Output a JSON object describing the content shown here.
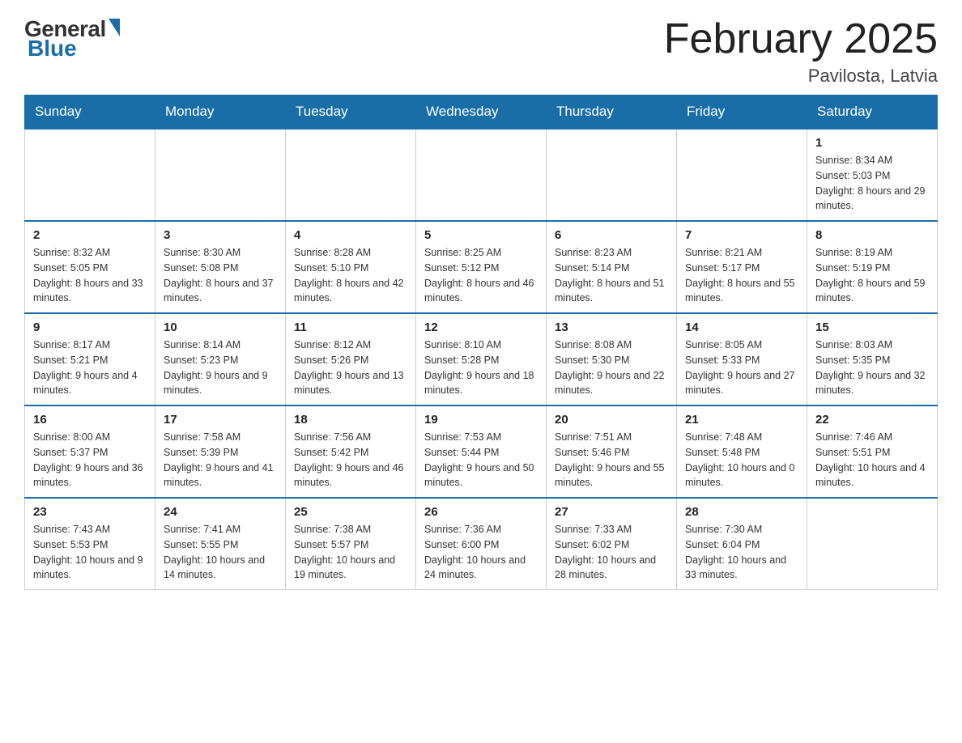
{
  "logo": {
    "general": "General",
    "blue": "Blue"
  },
  "title": {
    "month_year": "February 2025",
    "location": "Pavilosta, Latvia"
  },
  "headers": [
    "Sunday",
    "Monday",
    "Tuesday",
    "Wednesday",
    "Thursday",
    "Friday",
    "Saturday"
  ],
  "weeks": [
    [
      {
        "day": "",
        "info": ""
      },
      {
        "day": "",
        "info": ""
      },
      {
        "day": "",
        "info": ""
      },
      {
        "day": "",
        "info": ""
      },
      {
        "day": "",
        "info": ""
      },
      {
        "day": "",
        "info": ""
      },
      {
        "day": "1",
        "info": "Sunrise: 8:34 AM\nSunset: 5:03 PM\nDaylight: 8 hours and 29 minutes."
      }
    ],
    [
      {
        "day": "2",
        "info": "Sunrise: 8:32 AM\nSunset: 5:05 PM\nDaylight: 8 hours and 33 minutes."
      },
      {
        "day": "3",
        "info": "Sunrise: 8:30 AM\nSunset: 5:08 PM\nDaylight: 8 hours and 37 minutes."
      },
      {
        "day": "4",
        "info": "Sunrise: 8:28 AM\nSunset: 5:10 PM\nDaylight: 8 hours and 42 minutes."
      },
      {
        "day": "5",
        "info": "Sunrise: 8:25 AM\nSunset: 5:12 PM\nDaylight: 8 hours and 46 minutes."
      },
      {
        "day": "6",
        "info": "Sunrise: 8:23 AM\nSunset: 5:14 PM\nDaylight: 8 hours and 51 minutes."
      },
      {
        "day": "7",
        "info": "Sunrise: 8:21 AM\nSunset: 5:17 PM\nDaylight: 8 hours and 55 minutes."
      },
      {
        "day": "8",
        "info": "Sunrise: 8:19 AM\nSunset: 5:19 PM\nDaylight: 8 hours and 59 minutes."
      }
    ],
    [
      {
        "day": "9",
        "info": "Sunrise: 8:17 AM\nSunset: 5:21 PM\nDaylight: 9 hours and 4 minutes."
      },
      {
        "day": "10",
        "info": "Sunrise: 8:14 AM\nSunset: 5:23 PM\nDaylight: 9 hours and 9 minutes."
      },
      {
        "day": "11",
        "info": "Sunrise: 8:12 AM\nSunset: 5:26 PM\nDaylight: 9 hours and 13 minutes."
      },
      {
        "day": "12",
        "info": "Sunrise: 8:10 AM\nSunset: 5:28 PM\nDaylight: 9 hours and 18 minutes."
      },
      {
        "day": "13",
        "info": "Sunrise: 8:08 AM\nSunset: 5:30 PM\nDaylight: 9 hours and 22 minutes."
      },
      {
        "day": "14",
        "info": "Sunrise: 8:05 AM\nSunset: 5:33 PM\nDaylight: 9 hours and 27 minutes."
      },
      {
        "day": "15",
        "info": "Sunrise: 8:03 AM\nSunset: 5:35 PM\nDaylight: 9 hours and 32 minutes."
      }
    ],
    [
      {
        "day": "16",
        "info": "Sunrise: 8:00 AM\nSunset: 5:37 PM\nDaylight: 9 hours and 36 minutes."
      },
      {
        "day": "17",
        "info": "Sunrise: 7:58 AM\nSunset: 5:39 PM\nDaylight: 9 hours and 41 minutes."
      },
      {
        "day": "18",
        "info": "Sunrise: 7:56 AM\nSunset: 5:42 PM\nDaylight: 9 hours and 46 minutes."
      },
      {
        "day": "19",
        "info": "Sunrise: 7:53 AM\nSunset: 5:44 PM\nDaylight: 9 hours and 50 minutes."
      },
      {
        "day": "20",
        "info": "Sunrise: 7:51 AM\nSunset: 5:46 PM\nDaylight: 9 hours and 55 minutes."
      },
      {
        "day": "21",
        "info": "Sunrise: 7:48 AM\nSunset: 5:48 PM\nDaylight: 10 hours and 0 minutes."
      },
      {
        "day": "22",
        "info": "Sunrise: 7:46 AM\nSunset: 5:51 PM\nDaylight: 10 hours and 4 minutes."
      }
    ],
    [
      {
        "day": "23",
        "info": "Sunrise: 7:43 AM\nSunset: 5:53 PM\nDaylight: 10 hours and 9 minutes."
      },
      {
        "day": "24",
        "info": "Sunrise: 7:41 AM\nSunset: 5:55 PM\nDaylight: 10 hours and 14 minutes."
      },
      {
        "day": "25",
        "info": "Sunrise: 7:38 AM\nSunset: 5:57 PM\nDaylight: 10 hours and 19 minutes."
      },
      {
        "day": "26",
        "info": "Sunrise: 7:36 AM\nSunset: 6:00 PM\nDaylight: 10 hours and 24 minutes."
      },
      {
        "day": "27",
        "info": "Sunrise: 7:33 AM\nSunset: 6:02 PM\nDaylight: 10 hours and 28 minutes."
      },
      {
        "day": "28",
        "info": "Sunrise: 7:30 AM\nSunset: 6:04 PM\nDaylight: 10 hours and 33 minutes."
      },
      {
        "day": "",
        "info": ""
      }
    ]
  ]
}
